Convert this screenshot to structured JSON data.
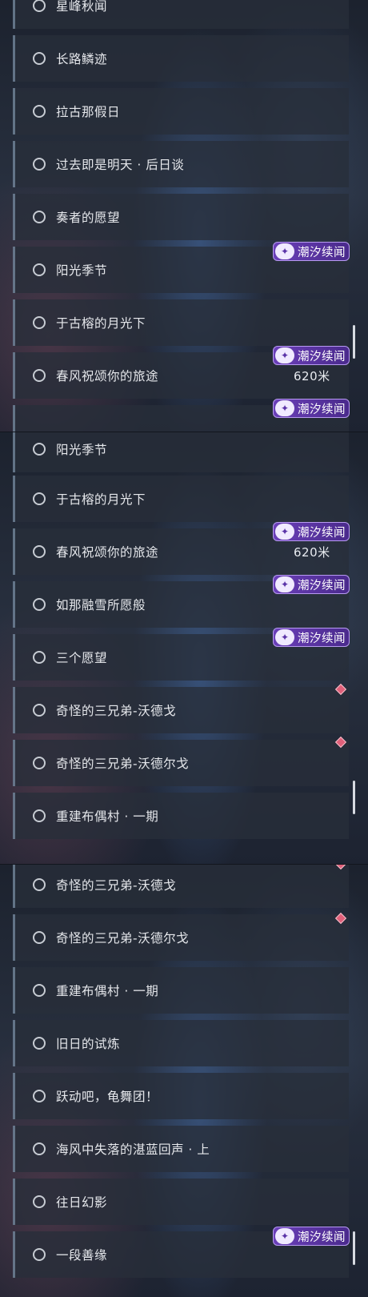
{
  "panels": [
    {
      "top_row_partial": "星峰秋闻",
      "rows": [
        "长路鳞迹",
        "拉古那假日",
        "过去即是明天 · 后日谈",
        "奏者的愿望",
        "阳光季节",
        "于古榕的月光下",
        "春风祝颂你的旅途"
      ],
      "badges": [
        "潮汐续闻",
        "潮汐续闻",
        "潮汐续闻"
      ],
      "distance": "620米"
    },
    {
      "rows": [
        "阳光季节",
        "于古榕的月光下",
        "春风祝颂你的旅途",
        "如那融雪所愿般",
        "三个愿望",
        "奇怪的三兄弟-沃德戈",
        "奇怪的三兄弟-沃德尔戈",
        "重建布偶村 · 一期"
      ],
      "badges": [
        "潮汐续闻",
        "潮汐续闻",
        "潮汐续闻"
      ],
      "distance": "620米"
    },
    {
      "rows": [
        "奇怪的三兄弟-沃德戈",
        "奇怪的三兄弟-沃德尔戈",
        "重建布偶村 · 一期",
        "旧日的试炼",
        "跃动吧，龟舞团！",
        "海风中失落的湛蓝回声 · 上",
        "往日幻影",
        "一段善缘"
      ],
      "badges": [
        "潮汐续闻"
      ]
    }
  ],
  "icons": {
    "row_status": "circle-icon",
    "badge": "tide-logo-icon",
    "marker": "diamond-icon"
  }
}
